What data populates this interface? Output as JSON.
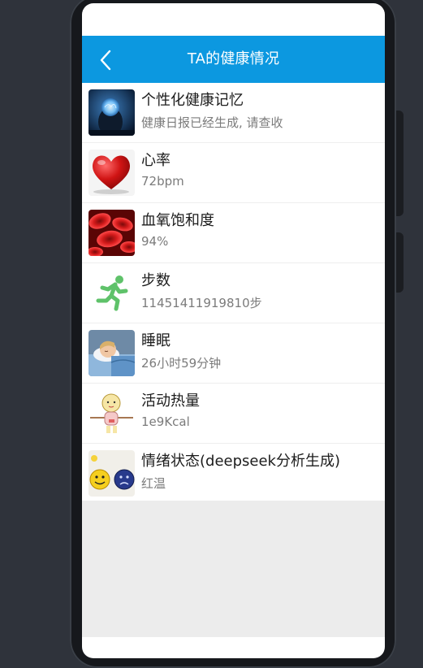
{
  "header": {
    "title": "TA的健康情况",
    "back_icon": "chevron-left-icon"
  },
  "colors": {
    "header_bg": "#0c98e0",
    "device_bg": "#2f333b",
    "empty_area": "#ececec"
  },
  "items": [
    {
      "title": "个性化健康记忆",
      "subtitle": "健康日报已经生成, 请查收",
      "icon": "brain-portrait-icon"
    },
    {
      "title": "心率",
      "subtitle": "72bpm",
      "icon": "heart-icon"
    },
    {
      "title": "血氧饱和度",
      "subtitle": "94%",
      "icon": "blood-cells-icon"
    },
    {
      "title": "步数",
      "subtitle": "11451411919810步",
      "icon": "running-person-icon"
    },
    {
      "title": "睡眠",
      "subtitle": "26小时59分钟",
      "icon": "sleeping-person-icon"
    },
    {
      "title": "活动热量",
      "subtitle": "1e9Kcal",
      "icon": "cartoon-character-icon"
    },
    {
      "title": "情绪状态(deepseek分析生成)",
      "subtitle": "红温",
      "icon": "emoji-faces-icon"
    }
  ]
}
